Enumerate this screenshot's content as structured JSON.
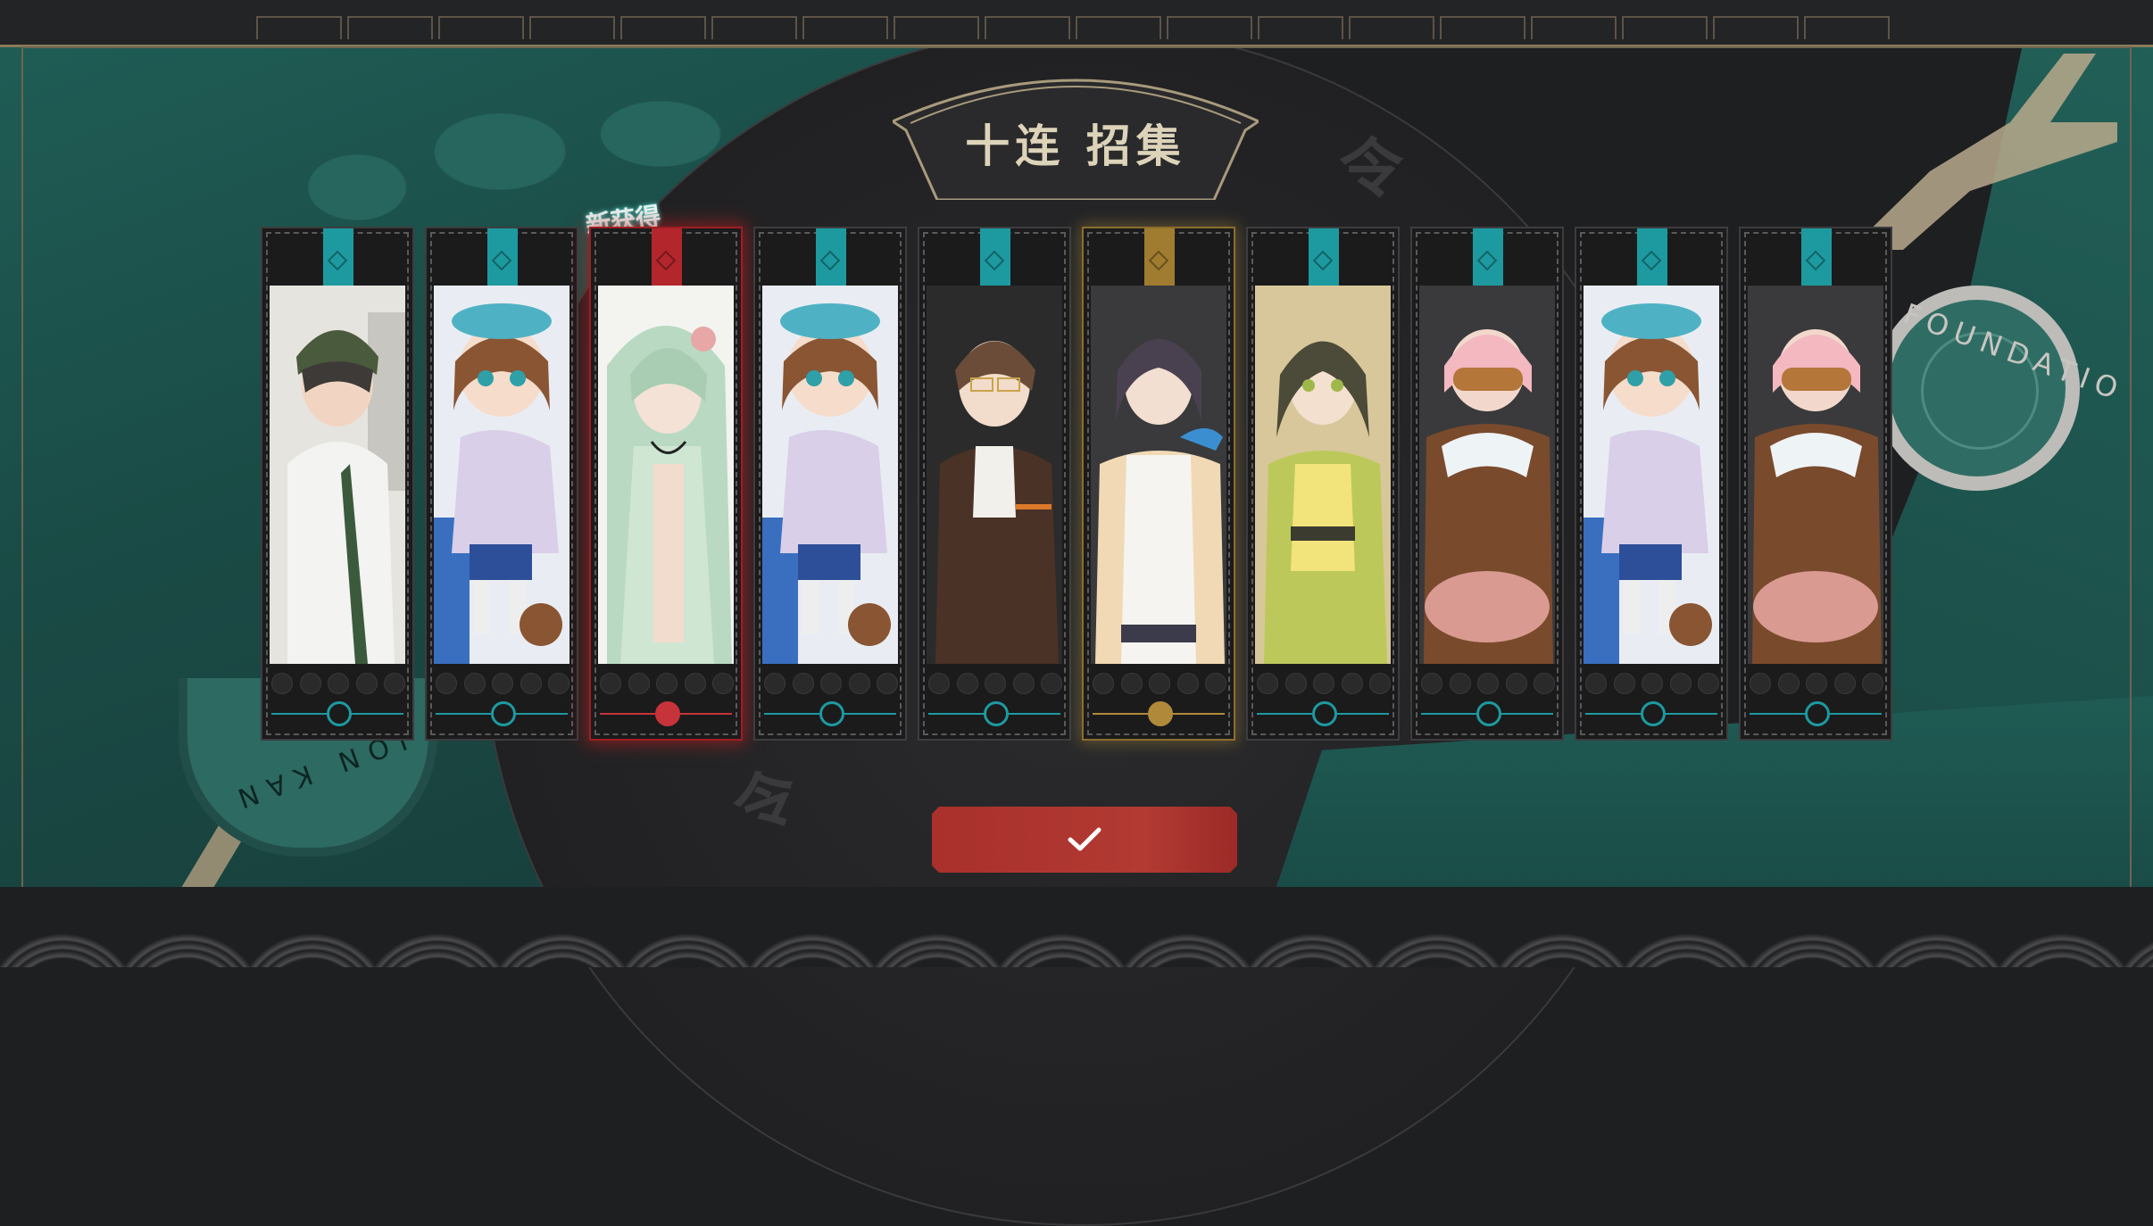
{
  "title": "十连 招集",
  "new_badge": "新获得",
  "background_text": {
    "seal_top": "令",
    "seal_left": "令",
    "emblem_left_text": "ION KAN",
    "emblem_right_text": "FOUNDATIO"
  },
  "confirm_icon": "checkmark-icon",
  "cards": [
    {
      "character": "green-cap-boy",
      "rarity": "standard",
      "color": "#1d9aa0",
      "is_new": false
    },
    {
      "character": "blue-beret-girl",
      "rarity": "standard",
      "color": "#1d9aa0",
      "is_new": false
    },
    {
      "character": "pale-green-haired-man",
      "rarity": "red",
      "color": "#b3262b",
      "is_new": true
    },
    {
      "character": "blue-beret-girl",
      "rarity": "standard",
      "color": "#1d9aa0",
      "is_new": false
    },
    {
      "character": "glasses-man-brown-vest",
      "rarity": "standard",
      "color": "#1d9aa0",
      "is_new": false
    },
    {
      "character": "dark-haired-robed-man",
      "rarity": "gold",
      "color": "#a07c30",
      "is_new": false
    },
    {
      "character": "green-dress-girl",
      "rarity": "standard",
      "color": "#1d9aa0",
      "is_new": false
    },
    {
      "character": "pink-haired-armored-boy",
      "rarity": "standard",
      "color": "#1d9aa0",
      "is_new": false
    },
    {
      "character": "blue-beret-girl",
      "rarity": "standard",
      "color": "#1d9aa0",
      "is_new": false
    },
    {
      "character": "pink-haired-armored-boy",
      "rarity": "standard",
      "color": "#1d9aa0",
      "is_new": false
    }
  ],
  "colors": {
    "accent_teal": "#1d9aa0",
    "rare_red": "#b3262b",
    "rare_gold": "#a07c30",
    "confirm_button": "#a9302b",
    "title_text": "#ddd3b9"
  }
}
